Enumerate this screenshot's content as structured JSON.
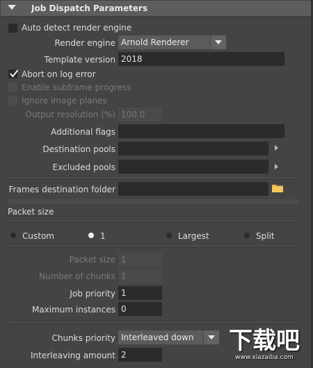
{
  "section": {
    "title": "Job Dispatch Parameters"
  },
  "auto_detect": {
    "label": "Auto detect render engine",
    "checked": false
  },
  "render_engine": {
    "label": "Render engine",
    "value": "Arnold Renderer"
  },
  "template_version": {
    "label": "Template version",
    "value": "2018"
  },
  "abort_on_log_error": {
    "label": "Abort on log error",
    "checked": true
  },
  "enable_subframe": {
    "label": "Enable subframe progress",
    "checked": false
  },
  "ignore_image_planes": {
    "label": "Ignore image planes",
    "checked": false
  },
  "output_resolution": {
    "label": "Output resolution (%)",
    "value": "100.0"
  },
  "additional_flags": {
    "label": "Additional flags",
    "value": ""
  },
  "destination_pools": {
    "label": "Destination pools",
    "value": ""
  },
  "excluded_pools": {
    "label": "Excluded pools",
    "value": ""
  },
  "frames_destination": {
    "label": "Frames destination folder",
    "value": ""
  },
  "packet_size": {
    "heading": "Packet size",
    "options": [
      "Custom",
      "1",
      "Largest",
      "Split"
    ],
    "selected": "1"
  },
  "packet_size_field": {
    "label": "Packet size",
    "value": "1"
  },
  "number_of_chunks": {
    "label": "Number of chunks",
    "value": "1"
  },
  "job_priority": {
    "label": "Job priority",
    "value": "1"
  },
  "maximum_instances": {
    "label": "Maximum instances",
    "value": "0"
  },
  "chunks_priority": {
    "label": "Chunks priority",
    "value": "Interleaved down"
  },
  "interleaving_amount": {
    "label": "Interleaving amount",
    "value": "2"
  },
  "watermark": {
    "text": "下载吧",
    "url": "www.xiazaiba.com"
  }
}
